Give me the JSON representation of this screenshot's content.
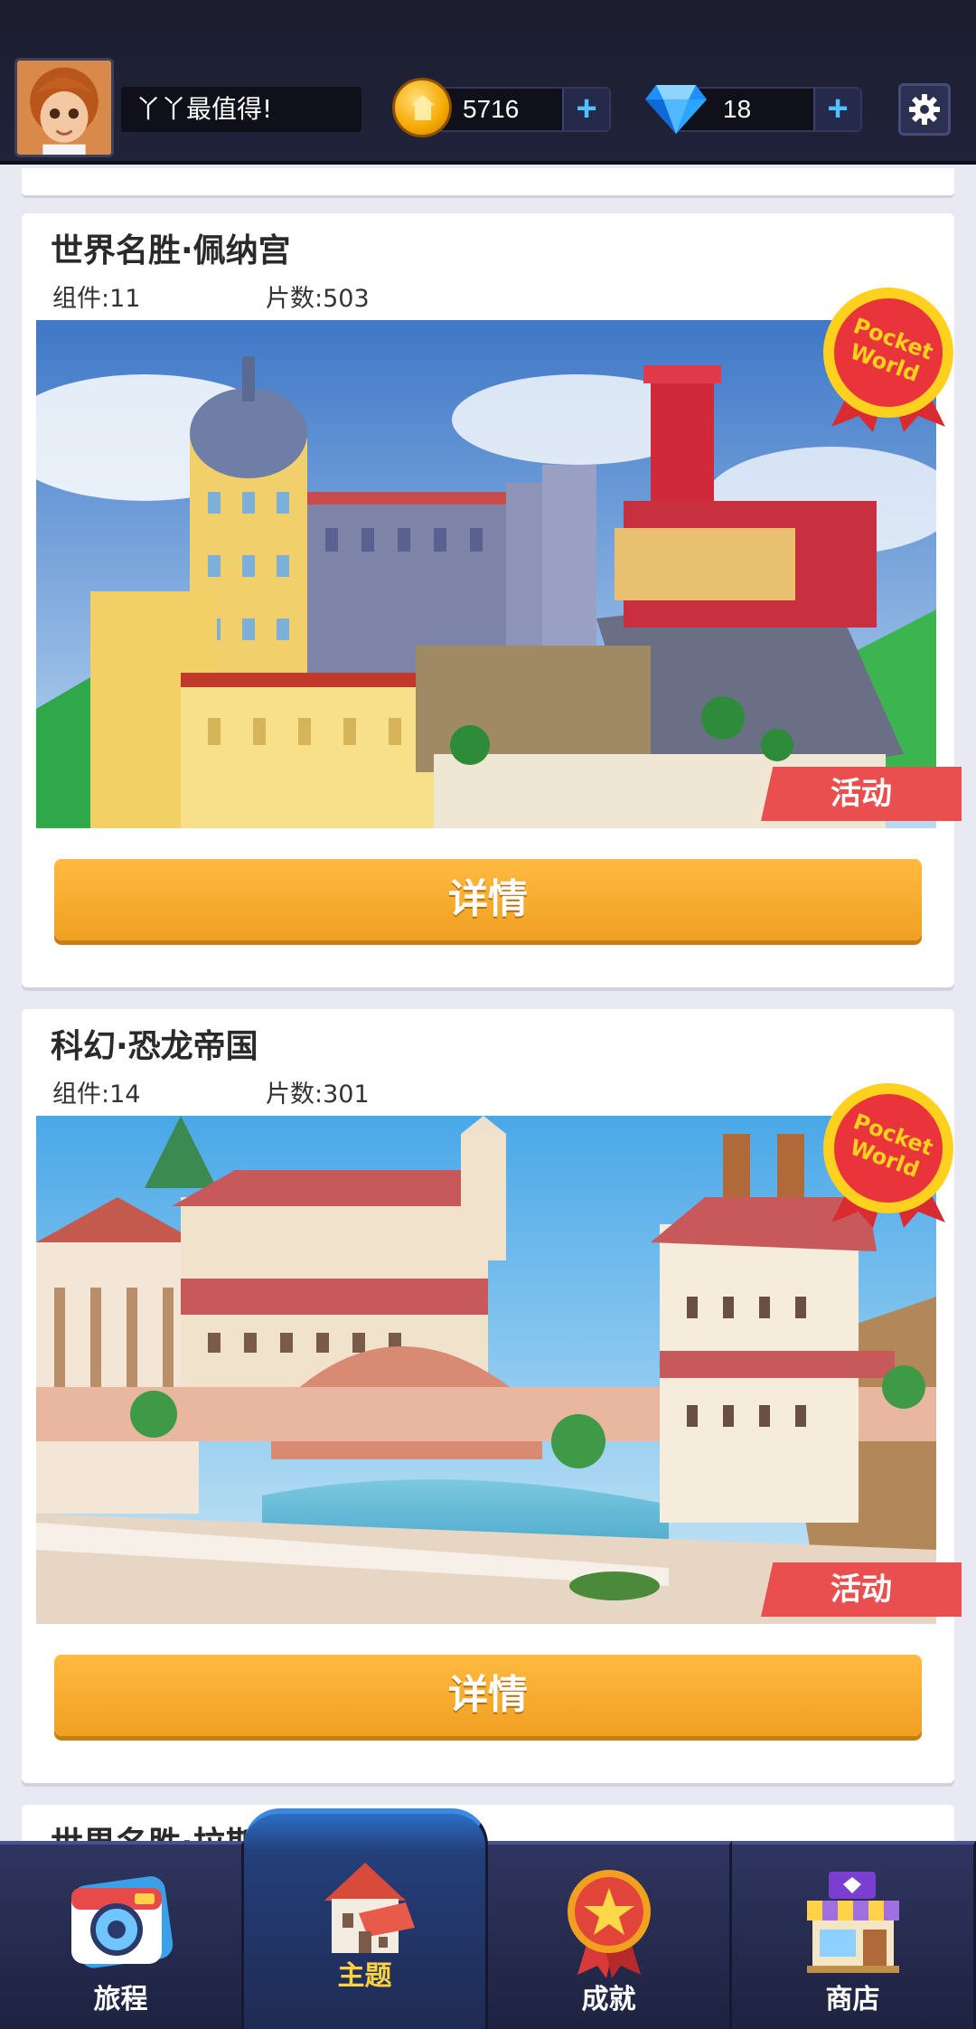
{
  "header": {
    "nickname": "丫丫最值得!",
    "coins": "5716",
    "gems": "18",
    "plus": "+"
  },
  "cards": [
    {
      "title": "世界名胜·佩纳宫",
      "components": "组件:11",
      "pieces": "片数:503",
      "badge_line1": "Pocket",
      "badge_line2": "World",
      "event_tag": "活动",
      "detail_label": "详情"
    },
    {
      "title": "科幻·恐龙帝国",
      "components": "组件:14",
      "pieces": "片数:301",
      "badge_line1": "Pocket",
      "badge_line2": "World",
      "event_tag": "活动",
      "detail_label": "详情"
    }
  ],
  "partial_card_title": "世界名胜·拉斯维",
  "nav": [
    {
      "label": "旅程",
      "icon": "camera-icon"
    },
    {
      "label": "主题",
      "icon": "house-icon"
    },
    {
      "label": "成就",
      "icon": "medal-icon"
    },
    {
      "label": "商店",
      "icon": "shop-icon"
    }
  ],
  "colors": {
    "accent_button": "#f5a623",
    "event_tag": "#ea4f4f",
    "active_nav_label": "#ffd23f",
    "plus": "#4fc3ff"
  }
}
